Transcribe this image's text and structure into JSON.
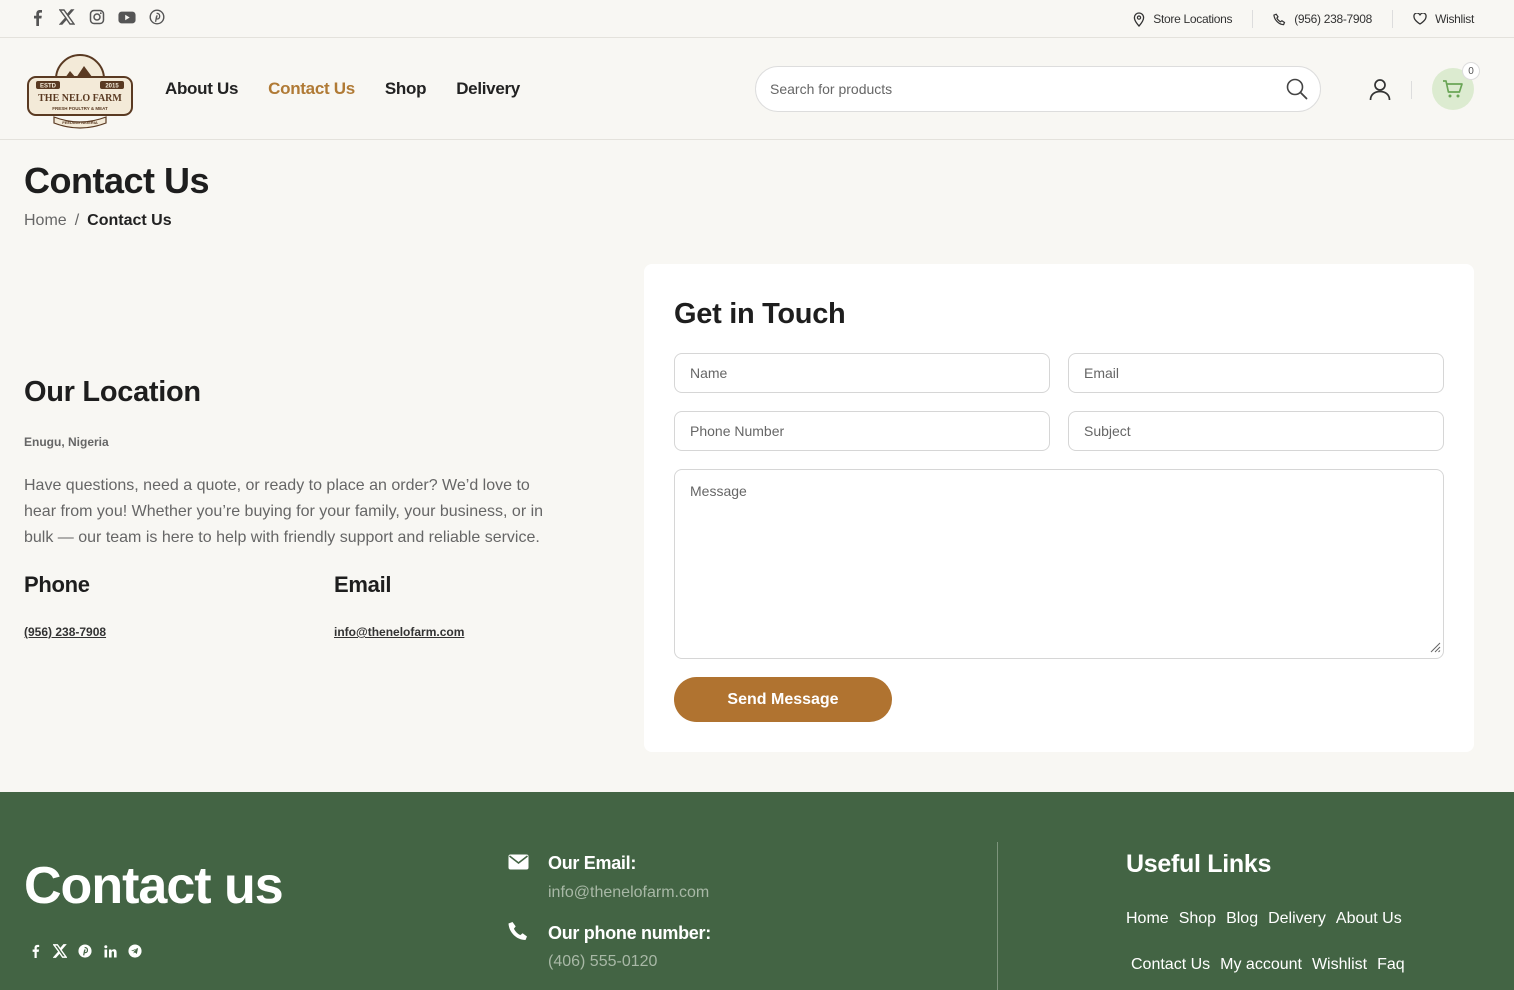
{
  "topbar": {
    "social": [
      "facebook-icon",
      "x-icon",
      "instagram-icon",
      "youtube-icon",
      "pinterest-icon"
    ],
    "store_locations": "Store Locations",
    "phone": "(956) 238-7908",
    "wishlist": "Wishlist"
  },
  "logo": {
    "estd": "ESTD",
    "year": "2015",
    "name": "THE NELO FARM",
    "tagline": "FRESH POULTRY & MEAT",
    "motto": "FEEDING NIGERIA"
  },
  "nav": [
    "About Us",
    "Contact Us",
    "Shop",
    "Delivery"
  ],
  "nav_active": "Contact Us",
  "search": {
    "placeholder": "Search for products"
  },
  "cart": {
    "count": "0"
  },
  "colors": {
    "accent": "#b07a35",
    "button": "#b07330",
    "footer": "#436444",
    "cart_bg": "#dcebd0"
  },
  "page": {
    "title": "Contact Us",
    "breadcrumb": {
      "home": "Home",
      "separator": "/",
      "current": "Contact Us"
    }
  },
  "location": {
    "title": "Our Location",
    "city": "Enugu, Nigeria",
    "description": "Have questions, need a quote, or ready to place an order? We’d love to hear from you! Whether you’re buying for your family, your business, or in bulk — our team is here to help with friendly support and reliable service.",
    "phone_label": "Phone",
    "phone_value": "(956) 238-7908",
    "email_label": "Email",
    "email_value": "info@thenelofarm.com"
  },
  "form": {
    "title": "Get in Touch",
    "name": "Name",
    "email": "Email",
    "phone": "Phone Number",
    "subject": "Subject",
    "message": "Message",
    "submit": "Send Message"
  },
  "footer": {
    "title": "Contact us",
    "social": [
      "facebook-icon",
      "x-icon",
      "pinterest-icon",
      "linkedin-icon",
      "telegram-icon"
    ],
    "email_label": "Our Email:",
    "email_value": "info@thenelofarm.com",
    "phone_label": "Our phone number:",
    "phone_value": "(406) 555-0120",
    "links_title": "Useful Links",
    "links_row1": [
      "Home",
      "Shop",
      "Blog",
      "Delivery",
      "About Us"
    ],
    "links_row2": [
      "Contact Us",
      "My account",
      "Wishlist",
      "Faq"
    ]
  }
}
